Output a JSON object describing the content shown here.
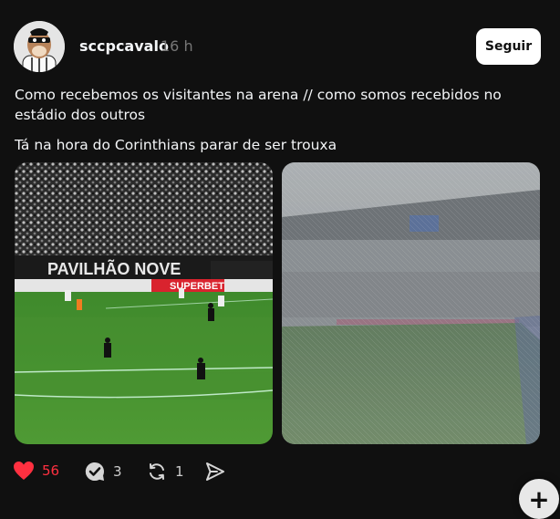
{
  "post": {
    "username": "sccpcavalo",
    "timestamp": "16 h",
    "follow_label": "Seguir",
    "paragraph1": "Como recebemos os visitantes na arena // como somos recebidos no estádio dos outros",
    "paragraph2": "Tá na hora do Corinthians parar de ser trouxa",
    "media": [
      {
        "stadium_banner_text": "PAVILHÃO NOVE",
        "ad_board_text": "SUPERBET"
      }
    ],
    "actions": {
      "likes": "56",
      "replies": "3",
      "reposts": "1"
    }
  },
  "fab": {
    "label": "+"
  },
  "colors": {
    "background": "#101010",
    "like": "#ff3040",
    "muted": "#777777"
  },
  "icons": [
    "heart-icon",
    "comment-icon",
    "repost-icon",
    "share-icon",
    "plus-icon"
  ]
}
